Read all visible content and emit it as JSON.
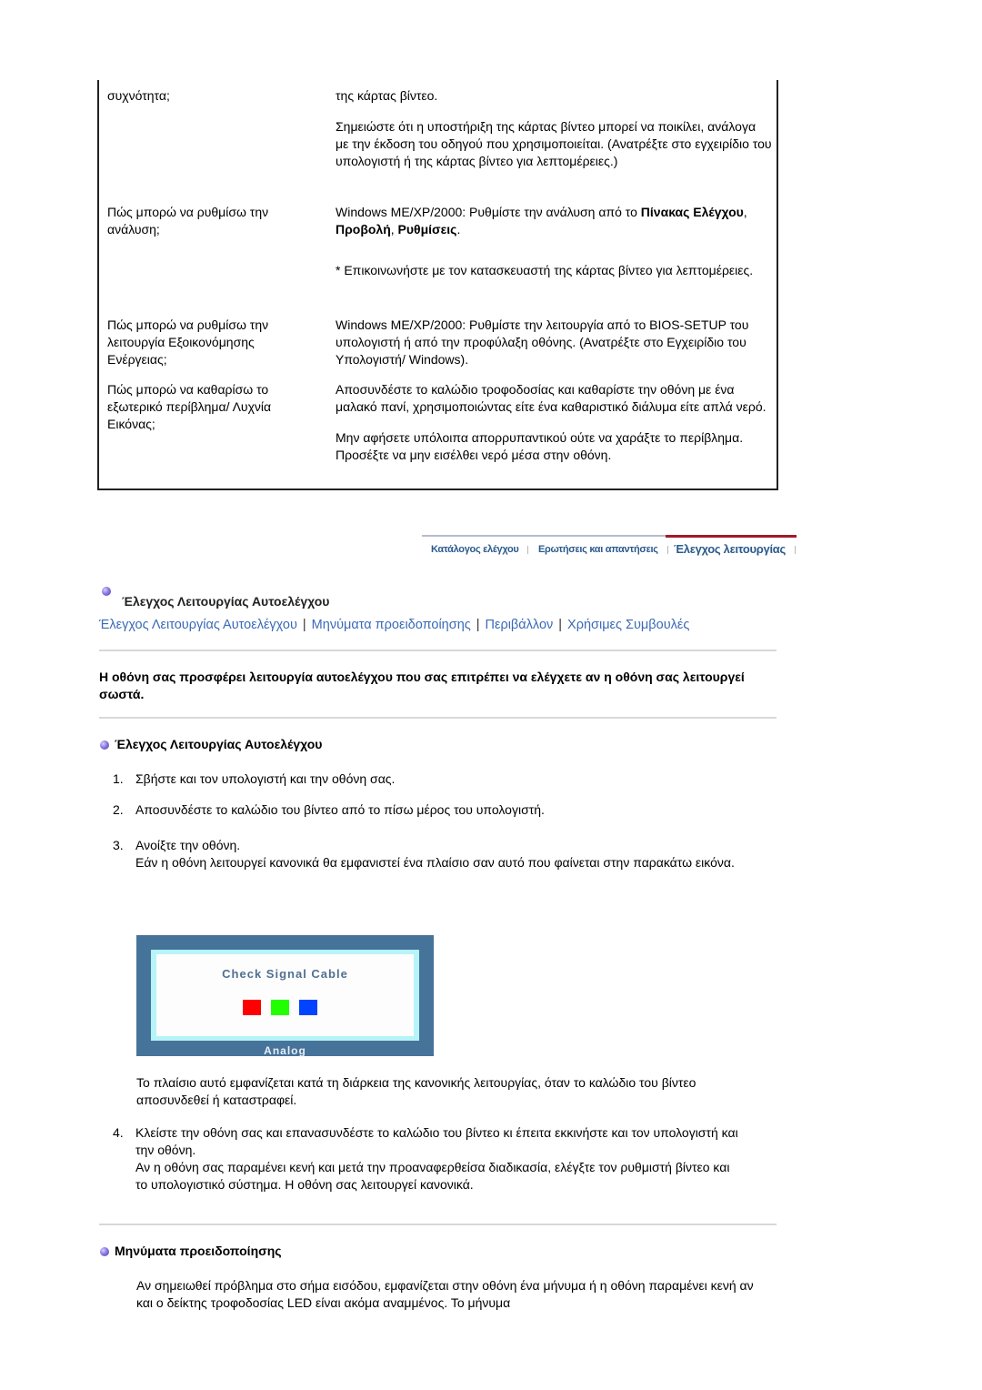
{
  "faq": [
    {
      "question": "συχνότητα;",
      "answers": [
        "της κάρτας βίντεο.",
        "Σημειώστε ότι η υποστήριξη της κάρτας βίντεο μπορεί να ποικίλει, ανάλογα με την έκδοση του οδηγού που χρησιμοποιείται. (Ανατρέξτε στο εγχειρίδιο του υπολογιστή ή της κάρτας βίντεο για λεπτομέρειες.)"
      ]
    },
    {
      "question": "Πώς μπορώ να ρυθμίσω την ανάλυση;",
      "answer_prefix": "Windows ME/XP/2000: Ρυθμίστε την ανάλυση από το ",
      "answer_bold_1": "Πίνακας Ελέγχου",
      "answer_sep_1": ", ",
      "answer_bold_2": "Προβολή",
      "answer_sep_2": ", ",
      "answer_bold_3": "Ρυθμίσεις",
      "answer_end": ".",
      "note": "* Επικοινωνήστε με τον κατασκευαστή της κάρτας βίντεο για λεπτομέρειες."
    },
    {
      "question": "Πώς μπορώ να ρυθμίσω την λειτουργία Εξοικονόμησης Ενέργειας;",
      "answer": "Windows ME/XP/2000: Ρυθμίστε την λειτουργία από το BIOS-SETUP του υπολογιστή ή από την προφύλαξη οθόνης. (Ανατρέξτε στο Εγχειρίδιο του Υπολογιστή/ Windows)."
    },
    {
      "question": "Πώς μπορώ να καθαρίσω το εξωτερικό περίβλημα/ Λυχνία Εικόνας;",
      "answers": [
        "Αποσυνδέστε το καλώδιο τροφοδοσίας και καθαρίστε την οθόνη με ένα μαλακό πανί, χρησιμοποιώντας είτε ένα καθαριστικό διάλυμα είτε απλά νερό.",
        "Μην αφήσετε υπόλοιπα απορρυπαντικού ούτε να χαράξτε το περίβλημα. Προσέξτε να μην εισέλθει νερό μέσα στην οθόνη."
      ]
    }
  ],
  "topnav": {
    "tabs": [
      "Κατάλογος ελέγχου",
      "Ερωτήσεις και απαντήσεις",
      "Έλεγχος λειτουργίας"
    ],
    "active_index": 2,
    "active_color": "#a3182a",
    "link_color": "#2a5a8c"
  },
  "page_title": "Έλεγχος Λειτουργίας Αυτοελέγχου",
  "section_links": [
    "Έλεγχος Λειτουργίας Αυτοελέγχου",
    "Μηνύματα προειδοποίησης",
    "Περιβάλλον",
    "Χρήσιμες Συμβουλές"
  ],
  "link_separator": "|",
  "intro": "Η οθόνη σας προσφέρει λειτουργία αυτοελέγχου που σας επιτρέπει να ελέγχετε αν η οθόνη σας λειτουργεί σωστά.",
  "self_test": {
    "heading": "Έλεγχος Λειτουργίας Αυτοελέγχου",
    "steps": [
      {
        "num": "1.",
        "text": "Σβήστε και τον υπολογιστή και την οθόνη σας."
      },
      {
        "num": "2.",
        "text": "Αποσυνδέστε το καλώδιο του βίντεο από το πίσω μέρος του υπολογιστή."
      },
      {
        "num": "3.",
        "text": "Ανοίξτε την οθόνη.",
        "detail": "Εάν η οθόνη λειτουργεί κανονικά θα εμφανιστεί ένα πλαίσιο σαν αυτό που φαίνεται στην παρακάτω εικόνα."
      },
      {
        "num": "4.",
        "text": "Κλείστε την οθόνη σας και επανασυνδέστε το καλώδιο του βίντεο κι έπειτα εκκινήστε και τον υπολογιστή και την οθόνη.",
        "detail": "Αν η οθόνη σας παραμένει κενή και μετά την προαναφερθείσα διαδικασία, ελέγξτε τον ρυθμιστή βίντεο και το υπολογιστικό σύστημα. Η οθόνη σας λειτουργεί κανονικά."
      }
    ],
    "osd": {
      "message": "Check Signal Cable",
      "mode": "Analog",
      "squares": [
        "#ff0000",
        "#22ff00",
        "#0044ff"
      ]
    },
    "osd_caption": "Το πλαίσιο αυτό εμφανίζεται κατά τη διάρκεια της κανονικής λειτουργίας, όταν το καλώδιο του βίντεο αποσυνδεθεί ή καταστραφεί."
  },
  "warnings": {
    "heading": "Μηνύματα προειδοποίησης",
    "text": "Αν σημειωθεί πρόβλημα στο σήμα εισόδου, εμφανίζεται στην οθόνη ένα μήνυμα ή η οθόνη παραμένει κενή αν και ο δείκτης τροφοδοσίας LED είναι ακόμα αναμμένος. Το μήνυμα"
  }
}
